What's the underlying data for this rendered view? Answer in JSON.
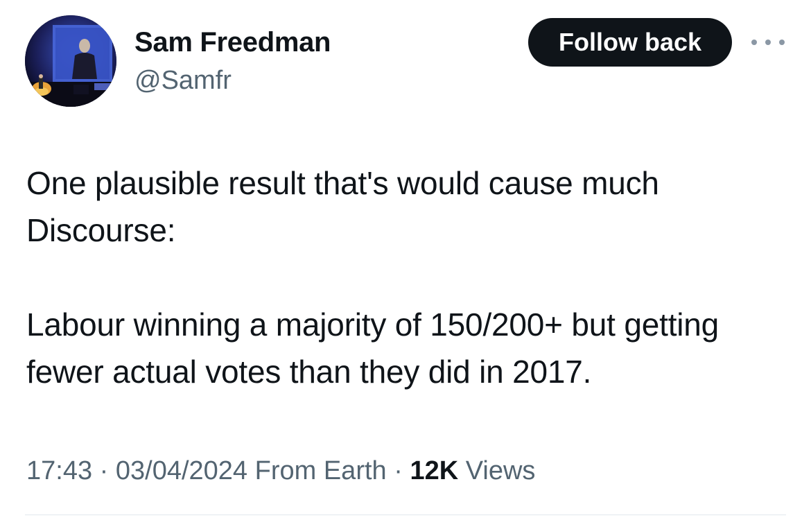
{
  "author": {
    "name": "Sam Freedman",
    "handle": "@Samfr"
  },
  "header": {
    "follow_label": "Follow back",
    "more_icon": "more-horizontal-icon"
  },
  "tweet": {
    "paragraphs": [
      "One plausible result that's would cause much Discourse:",
      "Labour winning a majority of 150/200+ but getting fewer actual votes than they did in 2017."
    ]
  },
  "meta": {
    "time": "17:43",
    "separator": "·",
    "date": "03/04/2024",
    "source": "From Earth",
    "views_count": "12K",
    "views_label": "Views"
  },
  "colors": {
    "text_primary": "#0f1419",
    "text_secondary": "#536471",
    "button_bg": "#0f1419",
    "button_text": "#ffffff",
    "divider": "#e1e8ed"
  }
}
